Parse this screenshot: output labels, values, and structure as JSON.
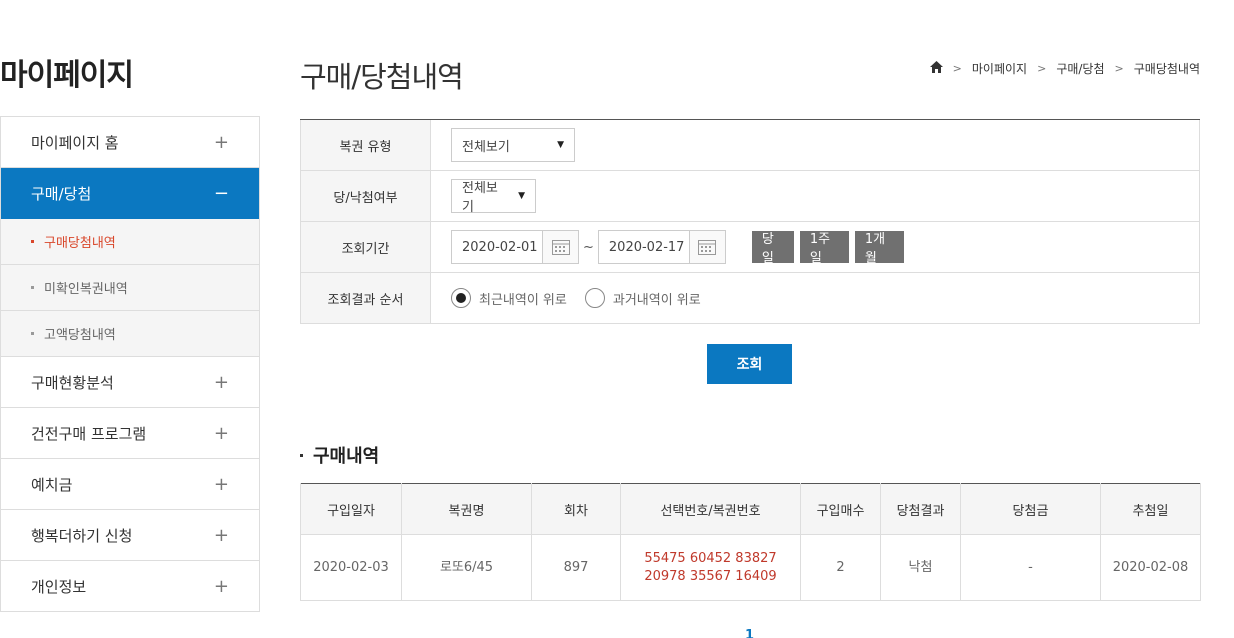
{
  "sidebar": {
    "title": "마이페이지",
    "items": [
      {
        "label": "마이페이지 홈",
        "sign": "+"
      },
      {
        "label": "구매/당첨",
        "sign": "−"
      },
      {
        "label": "구매현황분석",
        "sign": "+"
      },
      {
        "label": "건전구매 프로그램",
        "sign": "+"
      },
      {
        "label": "예치금",
        "sign": "+"
      },
      {
        "label": "행복더하기 신청",
        "sign": "+"
      },
      {
        "label": "개인정보",
        "sign": "+"
      }
    ],
    "subitems": [
      "구매당첨내역",
      "미확인복권내역",
      "고액당첨내역"
    ]
  },
  "header": {
    "title": "구매/당첨내역",
    "breadcrumb": [
      "마이페이지",
      "구매/당첨",
      "구매당첨내역"
    ]
  },
  "search": {
    "type_label": "복권 유형",
    "type_value": "전체보기",
    "win_label": "당/낙첨여부",
    "win_value": "전체보기",
    "period_label": "조회기간",
    "date_from": "2020-02-01",
    "date_sep": "~",
    "date_to": "2020-02-17",
    "period_buttons": [
      "당일",
      "1주일",
      "1개월"
    ],
    "order_label": "조회결과 순서",
    "order_options": [
      "최근내역이 위로",
      "과거내역이 위로"
    ],
    "submit": "조회"
  },
  "result": {
    "title": "구매내역",
    "columns": [
      "구입일자",
      "복권명",
      "회차",
      "선택번호/복권번호",
      "구입매수",
      "당첨결과",
      "당첨금",
      "추첨일"
    ],
    "rows": [
      [
        "2020-02-03",
        "로또6/45",
        "897",
        "55475 60452 83827 20978 35567 16409",
        "2",
        "낙첨",
        "-",
        "2020-02-08"
      ]
    ]
  },
  "pager": {
    "current": "1"
  },
  "colors": {
    "accent": "#0b78c1",
    "highlight": "#d9472b"
  }
}
